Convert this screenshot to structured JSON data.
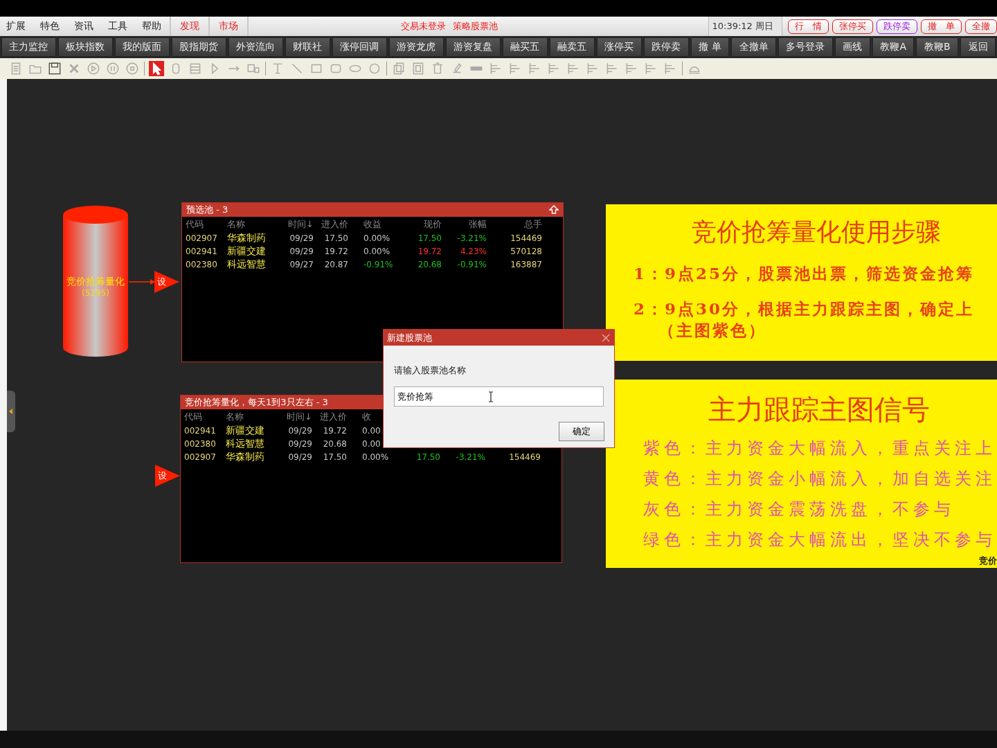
{
  "menu": [
    {
      "label": "扩展"
    },
    {
      "label": "特色"
    },
    {
      "label": "资讯"
    },
    {
      "label": "工具"
    },
    {
      "label": "帮助"
    }
  ],
  "tabs": [
    {
      "label": "发现"
    },
    {
      "label": "市场"
    }
  ],
  "status": {
    "login": "交易未登录",
    "page_title": "策略股票池",
    "clock": "10:39:12 周日"
  },
  "trade_buttons": [
    {
      "label": "行　情",
      "color": "#e02020"
    },
    {
      "label": "张停买",
      "color": "#e02020"
    },
    {
      "label": "跌停卖",
      "color": "#9a20e0"
    },
    {
      "label": "撤　单",
      "color": "#e02020"
    },
    {
      "label": "全撤",
      "color": "#e02020"
    }
  ],
  "function_buttons": [
    "主力监控",
    "板块指数",
    "我的版面",
    "股指期货",
    "外资流向",
    "财联社",
    "涨停回调",
    "游资龙虎",
    "游资复盘",
    "融买五",
    "融卖五",
    "涨停买",
    "跌停卖",
    "撤 单",
    "全撤单",
    "多号登录",
    "画线",
    "教鞭A",
    "教鞭B",
    "返回"
  ],
  "tool_groups": [
    [
      {
        "kind": "document",
        "selected": false
      },
      {
        "kind": "folder",
        "selected": false
      },
      {
        "kind": "save",
        "selected": false
      },
      {
        "kind": "cross",
        "selected": false
      },
      {
        "kind": "play",
        "selected": false
      },
      {
        "kind": "pause",
        "selected": false
      },
      {
        "kind": "stop",
        "selected": false
      }
    ],
    [
      {
        "kind": "pointer",
        "selected": true
      },
      {
        "kind": "cylinder",
        "selected": false
      },
      {
        "kind": "table",
        "selected": false
      },
      {
        "kind": "triangle",
        "selected": false
      },
      {
        "kind": "arrow",
        "selected": false
      },
      {
        "kind": "chart",
        "selected": false
      }
    ],
    [
      {
        "kind": "text",
        "selected": false
      },
      {
        "kind": "line",
        "selected": false
      },
      {
        "kind": "rect",
        "selected": false
      },
      {
        "kind": "roundrect",
        "selected": false
      },
      {
        "kind": "ellipse",
        "selected": false
      },
      {
        "kind": "circle",
        "selected": false
      }
    ],
    [
      {
        "kind": "copy",
        "selected": false
      },
      {
        "kind": "frame",
        "selected": false
      },
      {
        "kind": "trash",
        "selected": false
      },
      {
        "kind": "paint",
        "selected": false
      },
      {
        "kind": "bar",
        "selected": false
      },
      {
        "kind": "align",
        "selected": false
      },
      {
        "kind": "align",
        "selected": false
      },
      {
        "kind": "align",
        "selected": false
      },
      {
        "kind": "align",
        "selected": false
      },
      {
        "kind": "align",
        "selected": false
      },
      {
        "kind": "align",
        "selected": false
      },
      {
        "kind": "align",
        "selected": false
      },
      {
        "kind": "align",
        "selected": false
      },
      {
        "kind": "align",
        "selected": false
      },
      {
        "kind": "align",
        "selected": false
      }
    ],
    [
      {
        "kind": "cloud",
        "selected": false
      }
    ]
  ],
  "source": {
    "label": "竞价抢筹量化",
    "count": "(5295)"
  },
  "pools": [
    {
      "title": "预选池 - 3",
      "marker": "设",
      "columns": [
        "代码",
        "名称",
        "时间↓",
        "进入价",
        "收益",
        "现价",
        "张幅",
        "总手"
      ],
      "rows": [
        {
          "code": "002907",
          "name": "华森制药",
          "time": "09/29",
          "entry": "17.50",
          "gain": {
            "text": "0.00%",
            "color": "#c8c8c8"
          },
          "price": "17.50",
          "change": "-3.21%",
          "color": "#20c020",
          "volume": "154469"
        },
        {
          "code": "002941",
          "name": "新疆交建",
          "time": "09/29",
          "entry": "19.72",
          "gain": {
            "text": "0.00%",
            "color": "#c8c8c8"
          },
          "price": "19.72",
          "change": "4.23%",
          "color": "#ff3232",
          "volume": "570128"
        },
        {
          "code": "002380",
          "name": "科远智慧",
          "time": "09/27",
          "entry": "20.87",
          "gain": {
            "text": "-0.91%",
            "color": "#20c020"
          },
          "price": "20.68",
          "change": "-0.91%",
          "color": "#20c020",
          "volume": "163887"
        }
      ]
    },
    {
      "title": "竞价抢筹量化，每天1到3只左右 - 3",
      "marker": "设",
      "columns": [
        "代码",
        "名称",
        "时间↓",
        "进入价",
        "收"
      ],
      "rows": [
        {
          "code": "002941",
          "name": "新疆交建",
          "time": "09/29",
          "entry": "19.72",
          "gain": {
            "text": "0.00",
            "color": "#c8c8c8"
          }
        },
        {
          "code": "002380",
          "name": "科远智慧",
          "time": "09/29",
          "entry": "20.68",
          "gain": {
            "text": "0.00",
            "color": "#c8c8c8"
          }
        },
        {
          "code": "002907",
          "name": "华森制药",
          "time": "09/29",
          "entry": "17.50",
          "gain": {
            "text": "0.00%",
            "color": "#c8c8c8"
          },
          "price": "17.50",
          "change": "-3.21%",
          "color": "#20c020",
          "volume": "154469"
        }
      ]
    }
  ],
  "dialog": {
    "title": "新建股票池",
    "prompt": "请输入股票池名称",
    "value": "竞价抢筹",
    "button": "确定"
  },
  "notes": [
    {
      "title": "竞价抢筹量化使用步骤",
      "kind": "steps",
      "lines": [
        "1：9点25分，股票池出票，筛选资金抢筹",
        "2：9点30分，根据主力跟踪主图，确定上",
        "（主图紫色）"
      ]
    },
    {
      "title": "主力跟踪主图信号",
      "kind": "signals",
      "lines": [
        "紫色：主力资金大幅流入，重点关注上",
        "黄色：主力资金小幅流入，加自选关注",
        "灰色：主力资金震荡洗盘，不参与",
        "绿色：主力资金大幅流出，坚决不参与"
      ],
      "footer": "竞价"
    }
  ]
}
